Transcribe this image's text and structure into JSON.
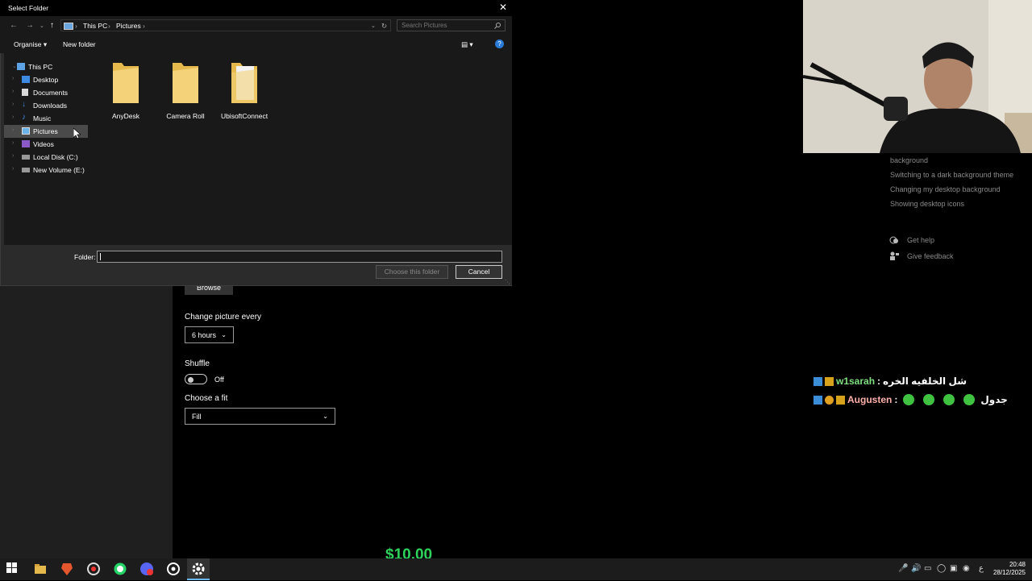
{
  "dialog": {
    "title": "Select Folder",
    "close_glyph": "✕",
    "breadcrumbs": [
      "This PC",
      "Pictures"
    ],
    "search_placeholder": "Search Pictures",
    "toolbar": {
      "organise": "Organise",
      "new_folder": "New folder"
    },
    "nav_items": [
      {
        "label": "This PC",
        "icon": "pc-icon"
      },
      {
        "label": "Desktop",
        "icon": "desktop-icon"
      },
      {
        "label": "Documents",
        "icon": "documents-icon"
      },
      {
        "label": "Downloads",
        "icon": "downloads-icon"
      },
      {
        "label": "Music",
        "icon": "music-icon"
      },
      {
        "label": "Pictures",
        "icon": "pictures-icon"
      },
      {
        "label": "Videos",
        "icon": "videos-icon"
      },
      {
        "label": "Local Disk (C:)",
        "icon": "drive-icon"
      },
      {
        "label": "New Volume (E:)",
        "icon": "drive-icon"
      }
    ],
    "selected_nav": "Pictures",
    "folders": [
      "AnyDesk",
      "Camera Roll",
      "UbisoftConnect"
    ],
    "folder_label": "Folder:",
    "folder_value": "",
    "choose_button": "Choose this folder",
    "cancel_button": "Cancel"
  },
  "settings": {
    "browse": "Browse",
    "change_picture_label": "Change picture every",
    "change_picture_value": "6 hours",
    "shuffle_label": "Shuffle",
    "shuffle_state": "Off",
    "fit_label": "Choose a fit",
    "fit_value": "Fill"
  },
  "related": {
    "items": [
      "background",
      "Switching to a dark background theme",
      "Changing my desktop background",
      "Showing desktop icons"
    ],
    "get_help": "Get help",
    "give_feedback": "Give feedback"
  },
  "chat": [
    {
      "user": "w1sarah",
      "separator": ":",
      "message": "شل الخلفيه الخره",
      "user_color": "#7ee07e"
    },
    {
      "user": "Augusten",
      "separator": ":",
      "message": "جدول",
      "user_color": "#ffb0a8"
    }
  ],
  "donation": "$10.00",
  "clock": {
    "time": "20:48",
    "date": "28/12/2025"
  },
  "tray_lang": "ع"
}
